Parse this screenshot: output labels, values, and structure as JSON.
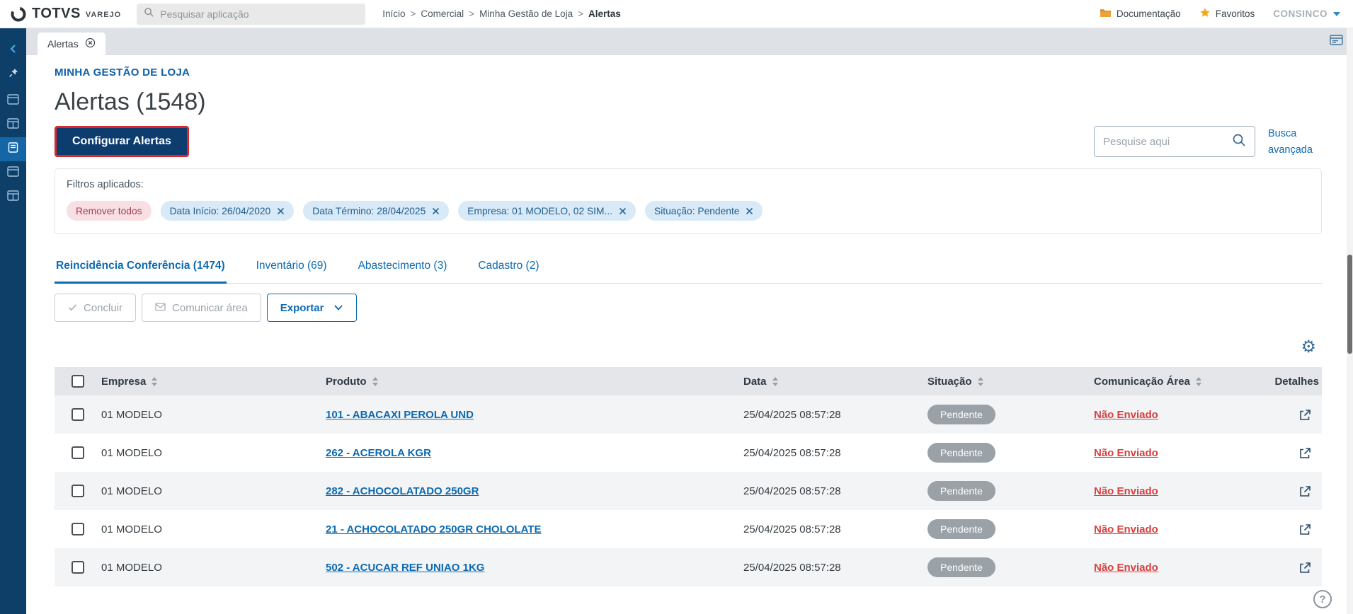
{
  "topbar": {
    "brand": {
      "name": "TOTVS",
      "product": "VAREJO"
    },
    "app_search": {
      "placeholder": "Pesquisar aplicação"
    },
    "breadcrumb": {
      "separator": ">",
      "items": [
        "Início",
        "Comercial",
        "Minha Gestão de Loja",
        "Alertas"
      ]
    },
    "documentation_label": "Documentação",
    "favorites_label": "Favoritos",
    "user_label": "CONSINCO"
  },
  "tabstrip": {
    "active_tab_label": "Alertas"
  },
  "page": {
    "module_title": "MINHA GESTÃO DE LOJA",
    "title": "Alertas (1548)",
    "configure_button_label": "Configurar Alertas",
    "search_placeholder": "Pesquise aqui",
    "advanced_search_label": "Busca avançada",
    "filters": {
      "label": "Filtros aplicados:",
      "remove_all_label": "Remover todos",
      "chips": [
        "Data Início: 26/04/2020",
        "Data Término: 28/04/2025",
        "Empresa: 01 MODELO, 02 SIM...",
        "Situação: Pendente"
      ]
    },
    "tabs": [
      {
        "label": "Reincidência Conferência (1474)"
      },
      {
        "label": "Inventário (69)"
      },
      {
        "label": "Abastecimento (3)"
      },
      {
        "label": "Cadastro (2)"
      }
    ],
    "actions": {
      "conclude_label": "Concluir",
      "communicate_label": "Comunicar área",
      "export_label": "Exportar"
    },
    "table": {
      "headers": {
        "empresa": "Empresa",
        "produto": "Produto",
        "data": "Data",
        "situacao": "Situação",
        "comunicacao": "Comunicação Área",
        "detalhes": "Detalhes"
      },
      "rows": [
        {
          "empresa": "01 MODELO",
          "produto": "101 - ABACAXI PEROLA UND",
          "data": "25/04/2025 08:57:28",
          "situacao": "Pendente",
          "comunicacao": "Não Enviado"
        },
        {
          "empresa": "01 MODELO",
          "produto": "262 - ACEROLA KGR",
          "data": "25/04/2025 08:57:28",
          "situacao": "Pendente",
          "comunicacao": "Não Enviado"
        },
        {
          "empresa": "01 MODELO",
          "produto": "282 - ACHOCOLATADO 250GR",
          "data": "25/04/2025 08:57:28",
          "situacao": "Pendente",
          "comunicacao": "Não Enviado"
        },
        {
          "empresa": "01 MODELO",
          "produto": "21 - ACHOCOLATADO 250GR CHOLOLATE",
          "data": "25/04/2025 08:57:28",
          "situacao": "Pendente",
          "comunicacao": "Não Enviado"
        },
        {
          "empresa": "01 MODELO",
          "produto": "502 - ACUCAR REF UNIAO 1KG",
          "data": "25/04/2025 08:57:28",
          "situacao": "Pendente",
          "comunicacao": "Não Enviado"
        }
      ]
    },
    "help_glyph": "?"
  },
  "colors": {
    "sidebar_navy": "#0e3f69",
    "primary_blue": "#0c6ab2",
    "configure_button_navy": "#0d3c6e",
    "highlight_red_border": "#d9272e",
    "pending_badge_gray": "#9aa1a7",
    "not_sent_red": "#d64040",
    "chip_blue_bg": "#d8e9f7",
    "chip_red_bg": "#f8dfe3"
  }
}
